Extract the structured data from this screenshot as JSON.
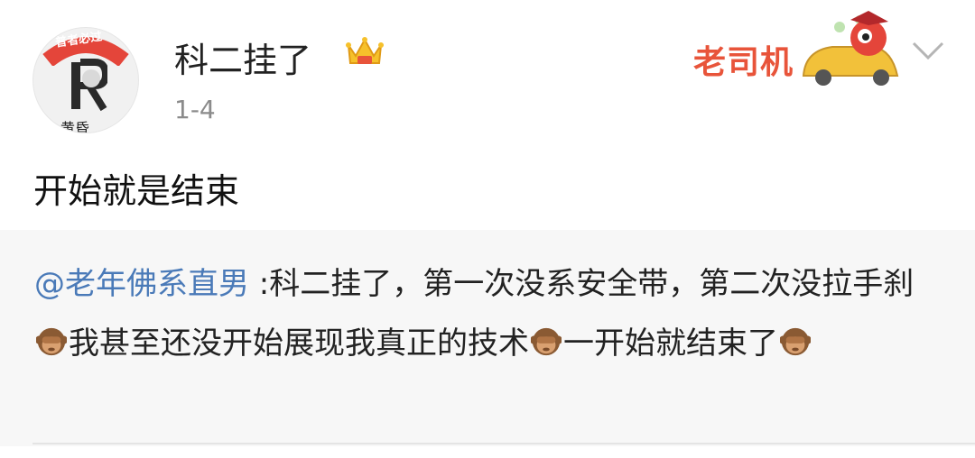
{
  "post": {
    "username": "科二挂了",
    "date": "1-4",
    "text": "开始就是结束",
    "avatar_ring_text": "普者必过",
    "avatar_bottom_text": "黄昏",
    "badge_text": "老司机"
  },
  "repost": {
    "mention": "@老年佛系直男",
    "segment1": " :科二挂了，第一次没系安全带，第二次没拉手刹",
    "segment2": "我甚至还没开始展现我真正的技术",
    "segment3": "一开始就结束了"
  },
  "icons": {
    "crown": "crown-icon",
    "chevron": "chevron-down-icon",
    "monkey": "see-no-evil-monkey-icon",
    "car": "car-icon"
  },
  "colors": {
    "mention": "#4a7ab8",
    "repost_bg": "#f7f7f7",
    "badge": "#e8543a"
  }
}
